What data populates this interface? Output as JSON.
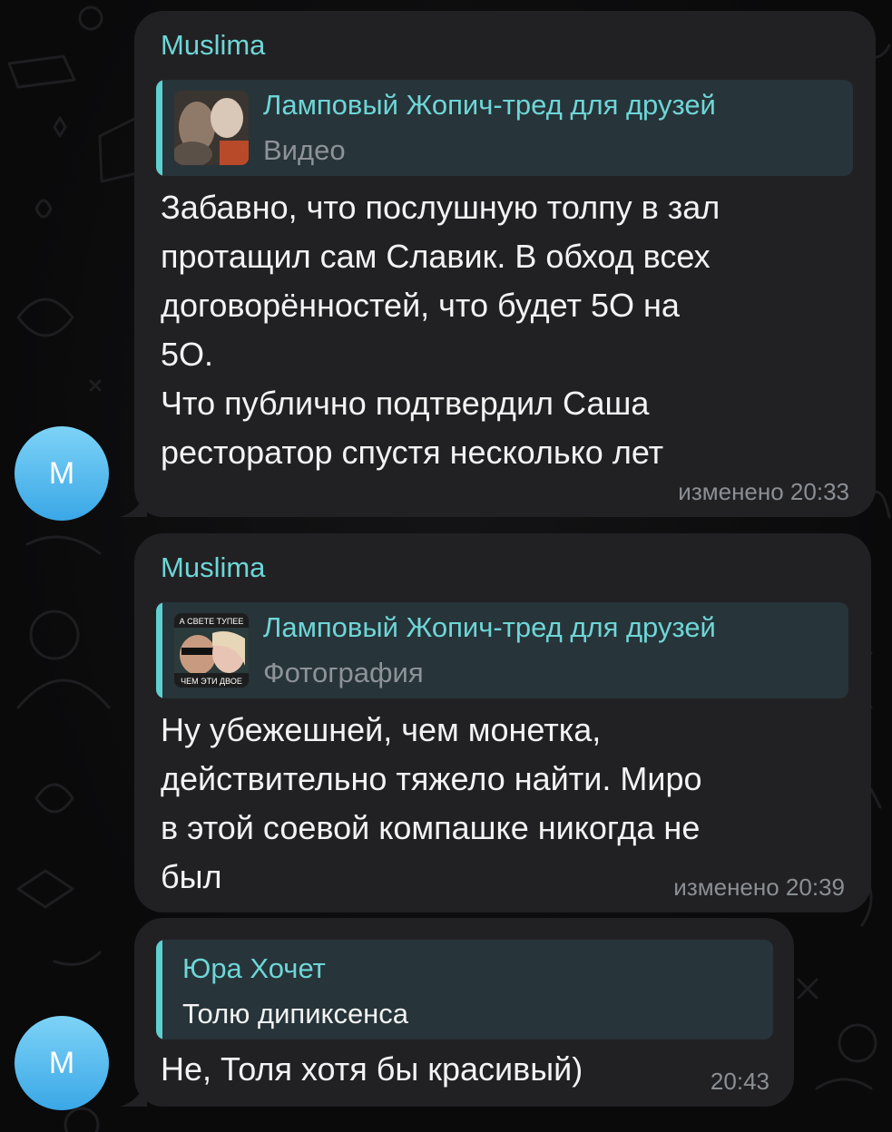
{
  "messages": [
    {
      "avatar_letter": "M",
      "sender": "Muslima",
      "reply": {
        "title": "Ламповый Жопич-тред для друзей",
        "subtitle": "Видео"
      },
      "text": "Забавно, что послушную толпу в зал\nпротащил сам Славик. В обход всех\nдоговорённостей, что будет 5О на\n5О.\nЧто публично подтвердил Саша\nресторатор спустя несколько лет",
      "meta": "изменено 20:33"
    },
    {
      "sender": "Muslima",
      "reply": {
        "title": "Ламповый Жопич-тред для друзей",
        "subtitle": "Фотография",
        "thumb_caption_top": "А СВЕТЕ ТУПЕЕ",
        "thumb_caption_bottom": "ЧЕМ ЭТИ ДВОЕ"
      },
      "text": "Ну убежешней, чем монетка,\nдействительно тяжело найти. Миро\nв этой соевой компашке никогда не\nбыл",
      "meta": "изменено 20:39"
    },
    {
      "avatar_letter": "M",
      "reply": {
        "title": "Юра Хочет",
        "subtitle": "Толю дипиксенса"
      },
      "text": "Не, Толя хотя бы красивый)",
      "meta": "20:43"
    }
  ],
  "colors": {
    "background": "#0b0b0d",
    "bubble": "#212124",
    "accent": "#6ed6d6",
    "reply_bg": "#27343a",
    "avatar": "#3aa7e6"
  },
  "icons": {
    "wallpaper": "doodle-pattern"
  }
}
